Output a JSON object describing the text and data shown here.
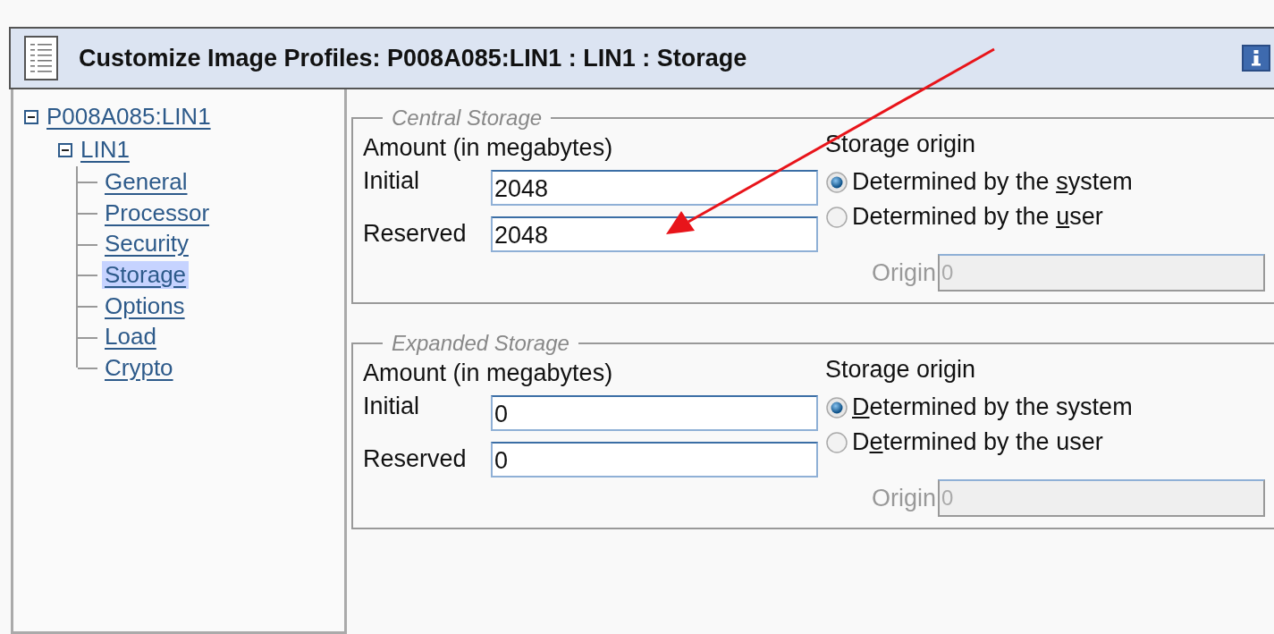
{
  "window": {
    "title": "Customize Image Profiles: P008A085:LIN1 : LIN1 : Storage"
  },
  "tree": [
    {
      "label": "P008A085:LIN1",
      "expanded": true,
      "selected": false,
      "children": [
        {
          "label": "LIN1",
          "expanded": true,
          "selected": false,
          "children": [
            {
              "label": "General",
              "selected": false
            },
            {
              "label": "Processor",
              "selected": false
            },
            {
              "label": "Security",
              "selected": false
            },
            {
              "label": "Storage",
              "selected": true
            },
            {
              "label": "Options",
              "selected": false
            },
            {
              "label": "Load",
              "selected": false
            },
            {
              "label": "Crypto",
              "selected": false
            }
          ]
        }
      ]
    }
  ],
  "groups": [
    {
      "title": "Central Storage",
      "amount_label": "Amount (in megabytes)",
      "fields": [
        {
          "label": "Initial",
          "value": "2048"
        },
        {
          "label": "Reserved",
          "value": "2048"
        }
      ],
      "origin_label": "Storage origin",
      "options": [
        {
          "before": "Determined by the ",
          "mnemonic": "s",
          "after": "ystem",
          "selected": true
        },
        {
          "before": "Determined by the ",
          "mnemonic": "u",
          "after": "ser",
          "selected": false
        }
      ],
      "origin_field": {
        "label": "Origin",
        "value": "0",
        "disabled": true
      }
    },
    {
      "title": "Expanded Storage",
      "amount_label": "Amount (in megabytes)",
      "fields": [
        {
          "label": "Initial",
          "value": "0"
        },
        {
          "label": "Reserved",
          "value": "0"
        }
      ],
      "origin_label": "Storage origin",
      "options": [
        {
          "mnemonic": "D",
          "after": "etermined by the system",
          "selected": true
        },
        {
          "before": "D",
          "mnemonic": "e",
          "after": "termined by the user",
          "selected": false
        }
      ],
      "origin_field": {
        "label": "Origin",
        "value": "0",
        "disabled": true
      }
    }
  ]
}
